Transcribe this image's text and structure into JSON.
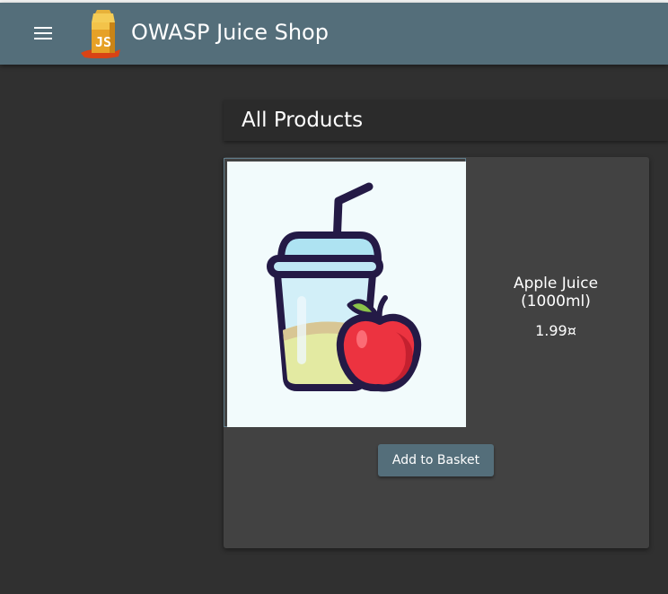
{
  "header": {
    "menu_icon": "menu-icon",
    "logo_icon": "juice-carton-logo-icon",
    "logo_text": "JS",
    "title": "OWASP Juice Shop"
  },
  "main": {
    "heading": "All Products",
    "products": [
      {
        "name_line1": "Apple Juice",
        "name_line2": "(1000ml)",
        "price": "1.99¤",
        "image_icon": "apple-juice-cup-icon",
        "button_label": "Add to Basket"
      }
    ]
  },
  "colors": {
    "toolbar": "#546e7a",
    "background": "#303030",
    "card": "#424242",
    "heading_bar": "#2b2b2b",
    "button": "#546e7a"
  }
}
